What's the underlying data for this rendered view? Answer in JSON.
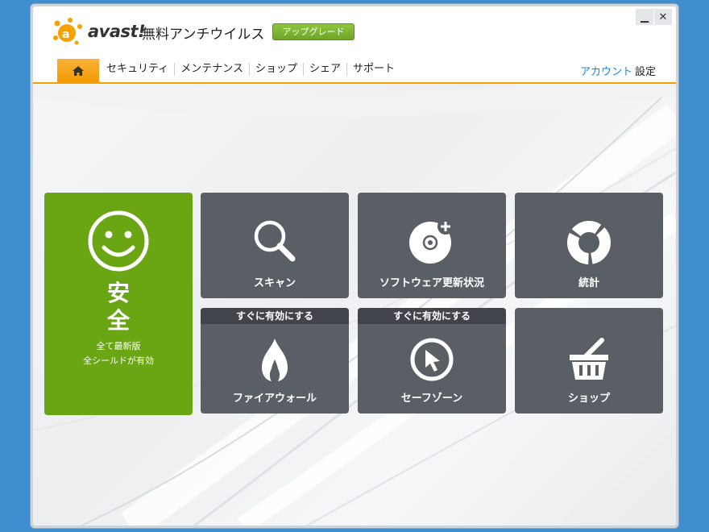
{
  "app": {
    "logo_text": "avast!",
    "product_name": "無料アンチウイルス",
    "upgrade_label": "アップグレード"
  },
  "window_controls": {
    "minimize": "▁",
    "close": "✕"
  },
  "nav": {
    "home_icon": "home-icon",
    "items": [
      {
        "label": "セキュリティ"
      },
      {
        "label": "メンテナンス"
      },
      {
        "label": "ショップ"
      },
      {
        "label": "シェア"
      },
      {
        "label": "サポート"
      }
    ],
    "account_label": "アカウント",
    "settings_label": "設定"
  },
  "status": {
    "title_line1": "安",
    "title_line2": "全",
    "line1": "全て最新版",
    "line2": "全シールドが有効"
  },
  "tiles": [
    {
      "label": "スキャン",
      "icon": "magnifier-icon"
    },
    {
      "label": "ソフトウェア更新状況",
      "icon": "software-update-icon"
    },
    {
      "label": "統計",
      "icon": "statistics-icon"
    },
    {
      "label": "ファイアウォール",
      "banner": "すぐに有効にする",
      "icon": "flame-icon"
    },
    {
      "label": "セーフゾーン",
      "banner": "すぐに有効にする",
      "icon": "cursor-icon"
    },
    {
      "label": "ショップ",
      "icon": "basket-icon"
    }
  ],
  "colors": {
    "accent": "#f7a100",
    "status_green": "#6aa514",
    "tile_gray": "#5a5f66",
    "link_blue": "#1e86c8",
    "upgrade_green": "#7cb832"
  }
}
